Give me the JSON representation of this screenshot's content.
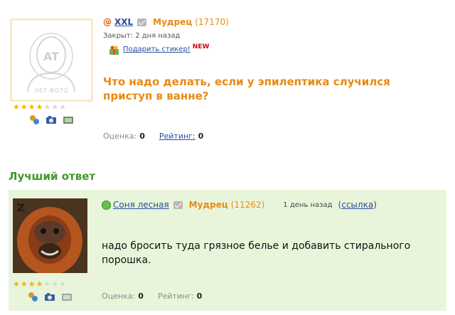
{
  "question": {
    "author": "XXL",
    "rank": "Мудрец",
    "score": "(17170)",
    "closed": "Закрыт: 2 дня назад",
    "gift_link": "Подарить стикер!",
    "new_badge": "NEW",
    "title": "Что надо делать, если у эпилептика случился приступ в ванне?",
    "avatar_placeholder": "НЕТ ФОТО",
    "rating_label": "Оценка:",
    "rating_value": "0",
    "rank_label": "Рейтинг:",
    "rank_value": "0",
    "stars": 4
  },
  "best_answer": {
    "heading": "Лучший ответ",
    "author": "Соня лесная",
    "rank": "Мудрец",
    "score": "(11262)",
    "time": "1 день назад",
    "link": "ссылка",
    "text": "надо бросить туда грязное белье и добавить стирального порошка.",
    "rating_label": "Оценка:",
    "rating_value": "0",
    "rank_label": "Рейтинг:",
    "rank_value": "0",
    "stars": 4
  },
  "colors": {
    "accent_orange": "#e88a13",
    "link_blue": "#2a4d9b",
    "best_green": "#3f9a26",
    "answer_bg": "#e9f5db"
  }
}
